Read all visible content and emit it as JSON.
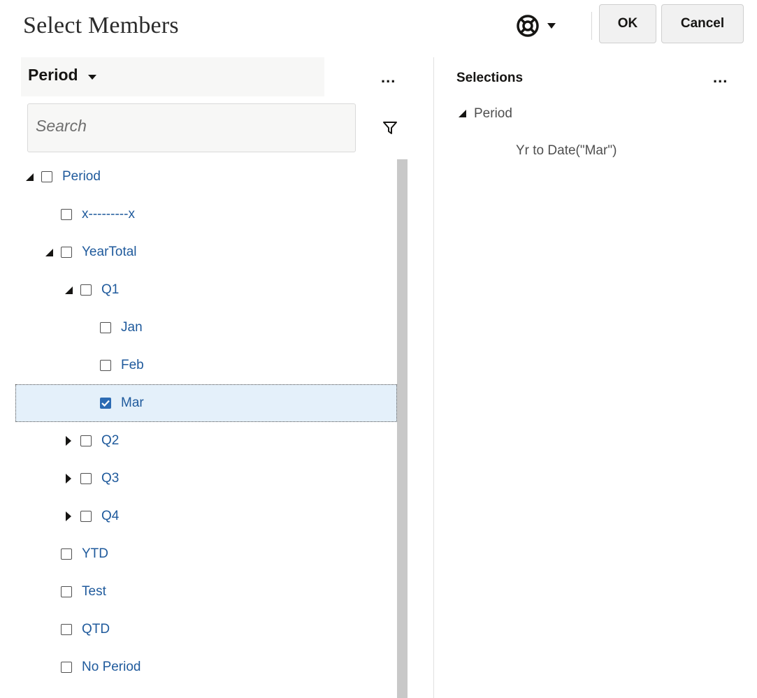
{
  "dialog": {
    "title": "Select Members"
  },
  "toolbar": {
    "ok_label": "OK",
    "cancel_label": "Cancel"
  },
  "left_panel": {
    "dimension_label": "Period",
    "more_label": "...",
    "search_placeholder": "Search"
  },
  "tree": [
    {
      "label": "Period",
      "level": 0,
      "expander": "expanded",
      "checked": false,
      "selected": false
    },
    {
      "label": "x---------x",
      "level": 1,
      "expander": "none",
      "checked": false,
      "selected": false
    },
    {
      "label": "YearTotal",
      "level": 1,
      "expander": "expanded",
      "checked": false,
      "selected": false
    },
    {
      "label": "Q1",
      "level": 2,
      "expander": "expanded",
      "checked": false,
      "selected": false
    },
    {
      "label": "Jan",
      "level": 3,
      "expander": "none",
      "checked": false,
      "selected": false
    },
    {
      "label": "Feb",
      "level": 3,
      "expander": "none",
      "checked": false,
      "selected": false
    },
    {
      "label": "Mar",
      "level": 3,
      "expander": "none",
      "checked": true,
      "selected": true
    },
    {
      "label": "Q2",
      "level": 2,
      "expander": "collapsed",
      "checked": false,
      "selected": false
    },
    {
      "label": "Q3",
      "level": 2,
      "expander": "collapsed",
      "checked": false,
      "selected": false
    },
    {
      "label": "Q4",
      "level": 2,
      "expander": "collapsed",
      "checked": false,
      "selected": false
    },
    {
      "label": "YTD",
      "level": 1,
      "expander": "none",
      "checked": false,
      "selected": false
    },
    {
      "label": "Test",
      "level": 1,
      "expander": "none",
      "checked": false,
      "selected": false
    },
    {
      "label": "QTD",
      "level": 1,
      "expander": "none",
      "checked": false,
      "selected": false
    },
    {
      "label": "No Period",
      "level": 1,
      "expander": "none",
      "checked": false,
      "selected": false
    }
  ],
  "right_panel": {
    "title": "Selections",
    "more_label": "...",
    "group_label": "Period",
    "items": [
      "Yr to Date(\"Mar\")"
    ]
  },
  "icons": {
    "help": "lifebuoy-icon",
    "dropdown": "caret-down-icon",
    "filter": "filter-icon",
    "expanded": "triangle-down-icon",
    "collapsed": "triangle-right-icon",
    "checkbox": "checkbox-icon"
  },
  "colors": {
    "link_text": "#1f5a9c",
    "selected_row_bg": "#e4f0fa",
    "checkbox_checked": "#2c6bb3"
  }
}
